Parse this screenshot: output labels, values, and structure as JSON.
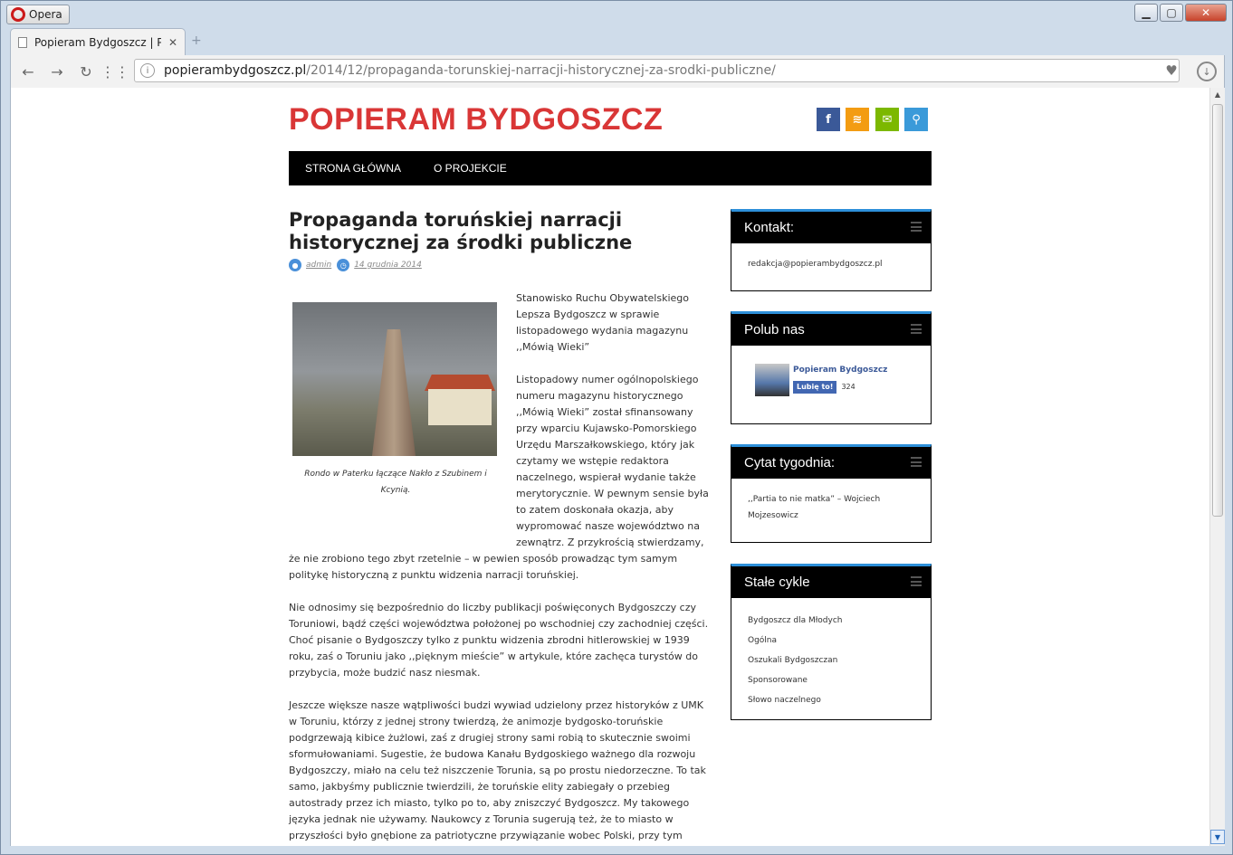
{
  "browser": {
    "app_name": "Opera",
    "window_controls": {
      "minimize": "▁",
      "maximize": "▢",
      "close": "✕"
    },
    "tab_title": "Popieram Bydgoszcz | Propaganda toruńskiej narracji historycznej za środki publiczne",
    "tab_close": "✕",
    "new_tab": "+",
    "url_host": "popierambydgoszcz.pl",
    "url_path": "/2014/12/propaganda-torunskiej-narracji-historycznej-za-srodki-publiczne/"
  },
  "header": {
    "site_title": "POPIERAM BYDGOSZCZ",
    "social": {
      "facebook": "f",
      "rss": "≋",
      "mail": "✉",
      "search": "⚲"
    }
  },
  "nav": {
    "items": [
      "STRONA GŁÓWNA",
      "O PROJEKCIE"
    ]
  },
  "post": {
    "title": "Propaganda toruńskiej narracji historycznej za środki publiczne",
    "author": "admin",
    "date": "14 grudnia 2014",
    "image_caption": "Rondo w Paterku łączące Nakło z Szubinem i Kcynią.",
    "paragraphs": [
      "Stanowisko Ruchu Obywatelskiego Lepsza Bydgoszcz w sprawie listopadowego wydania magazynu ,,Mówią Wieki”",
      "Listopadowy numer ogólnopolskiego numeru magazynu historycznego ,,Mówią Wieki” został sfinansowany przy wparciu Kujawsko-Pomorskiego Urzędu Marszałkowskiego, który jak czytamy we wstępie redaktora naczelnego, wspierał wydanie także merytorycznie. W pewnym sensie była to zatem doskonała okazja, aby wypromować nasze województwo na zewnątrz. Z przykrością stwierdzamy, że nie zrobiono tego zbyt rzetelnie – w pewien sposób prowadząc tym samym politykę historyczną z punktu widzenia narracji toruńskiej.",
      "Nie odnosimy się bezpośrednio do liczby publikacji poświęconych Bydgoszczy czy Toruniowi, bądź części województwa położonej po wschodniej czy zachodniej części. Choć pisanie o Bydgoszczy tylko z punktu widzenia zbrodni hitlerowskiej w 1939 roku, zaś o Toruniu jako ,,pięknym mieście” w artykule, które zachęca turystów do przybycia, może budzić nasz niesmak.",
      "Jeszcze większe nasze wątpliwości budzi wywiad udzielony przez historyków z UMK w Toruniu, którzy z jednej strony twierdzą, że animozje bydgosko-toruńskie podgrzewają kibice żużlowi, zaś z drugiej strony sami robią to skutecznie swoimi sformułowaniami. Sugestie, że budowa Kanału Bydgoskiego ważnego dla rozwoju Bydgoszczy, miało na celu też niszczenie Torunia, są po prostu niedorzeczne. To tak samo, jakbyśmy publicznie twierdzili, że toruńskie elity zabiegały o przebieg autostrady przez ich miasto, tylko po to, aby zniszczyć Bydgoszcz. My takowego języka jednak nie używamy. Naukowcy z Torunia sugerują też, że to miasto w przyszłości było gnębione za patriotyczne przywiązanie wobec Polski, przy tym sugerując, że to Torunianie najbardziej obok Poznania w czasie zaborów walczyli o"
    ]
  },
  "sidebar": {
    "contact": {
      "title": "Kontakt:",
      "email": "redakcja@popierambydgoszcz.pl"
    },
    "like": {
      "title": "Polub nas",
      "page_name": "Popieram Bydgoszcz",
      "like_button": "Lubię to!",
      "count": "324"
    },
    "quote": {
      "title": "Cytat tygodnia:",
      "text": ",,Partia to nie matka” – Wojciech Mojzesowicz"
    },
    "cycles": {
      "title": "Stałe cykle",
      "items": [
        "Bydgoszcz dla Młodych",
        "Ogólna",
        "Oszukali Bydgoszczan",
        "Sponsorowane",
        "Słowo naczelnego"
      ]
    }
  }
}
